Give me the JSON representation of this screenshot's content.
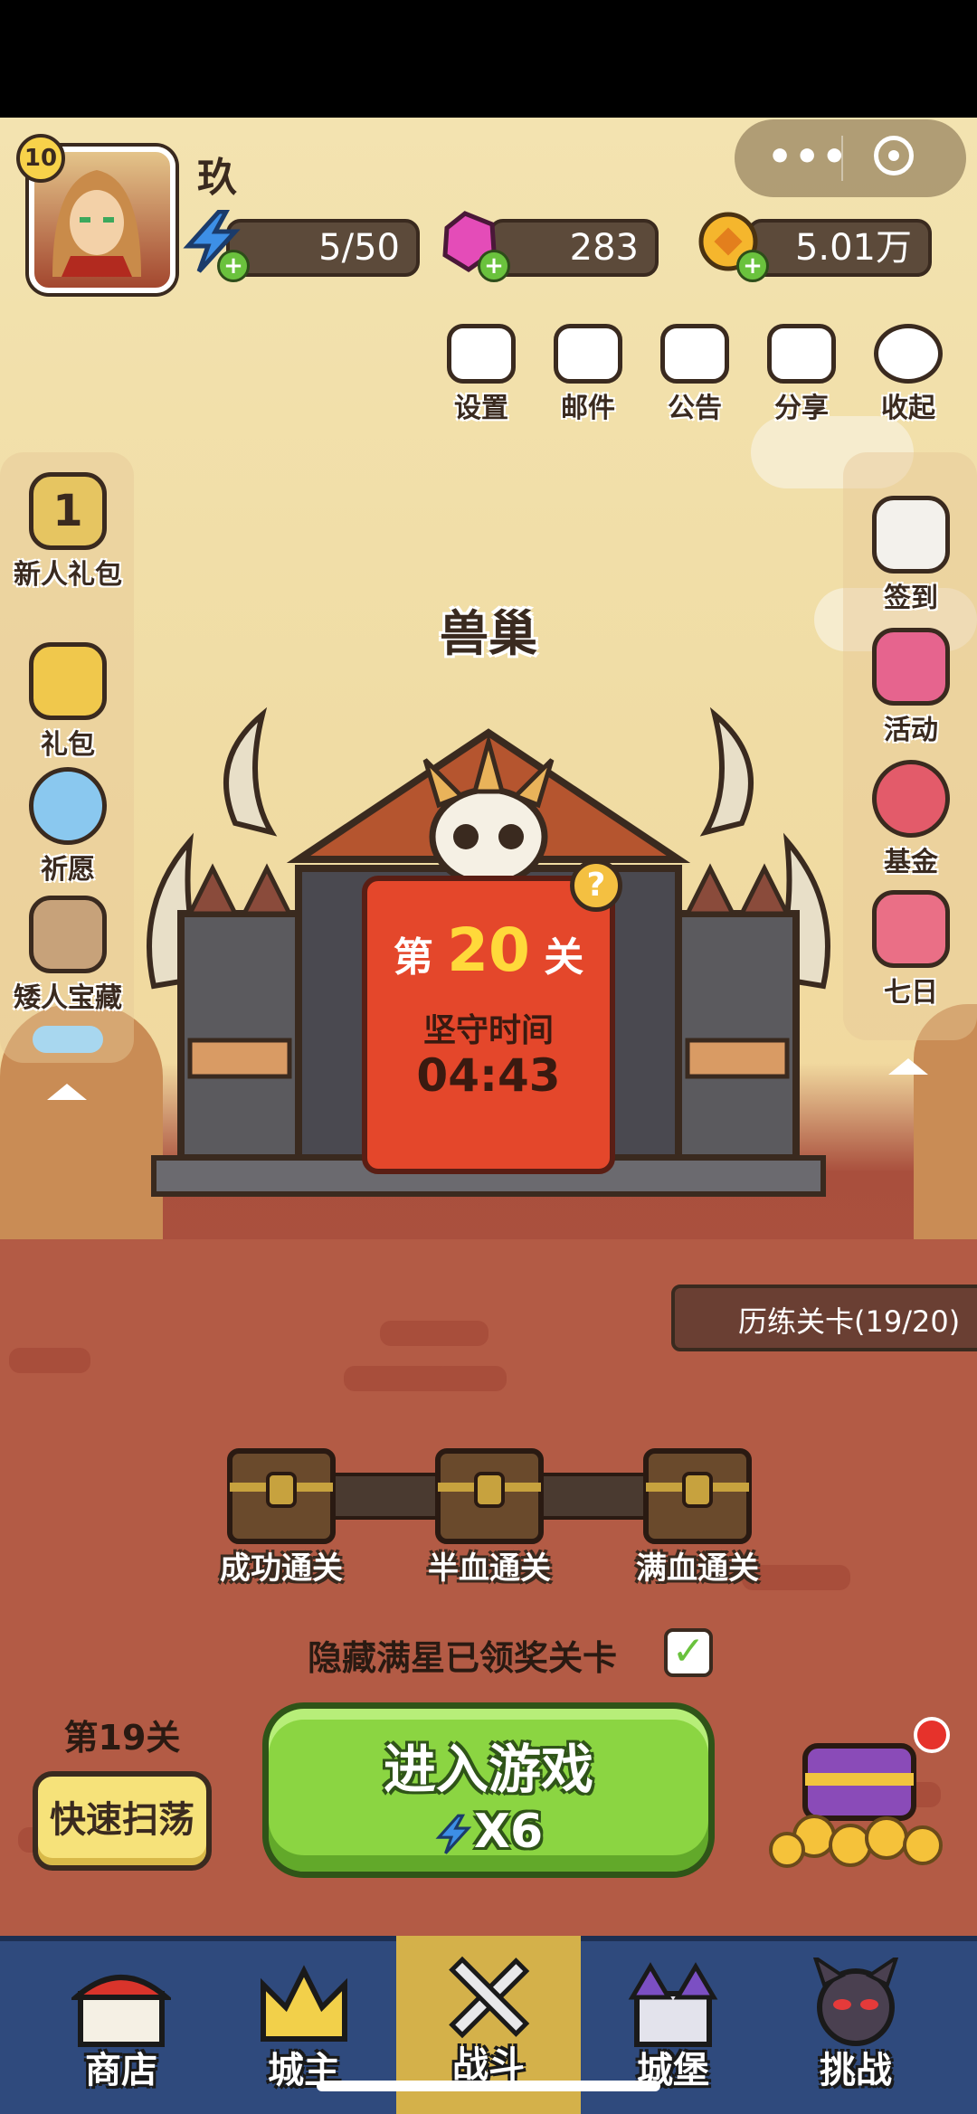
{
  "player": {
    "level": "10",
    "name": "玖"
  },
  "resources": {
    "energy": "5/50",
    "gems": "283",
    "gold": "5.01万"
  },
  "top_menu": [
    {
      "label": "设置",
      "icon": "gear-icon"
    },
    {
      "label": "邮件",
      "icon": "mail-icon"
    },
    {
      "label": "公告",
      "icon": "megaphone-icon"
    },
    {
      "label": "分享",
      "icon": "share-icon"
    },
    {
      "label": "收起",
      "icon": "collapse-icon"
    }
  ],
  "left_menu": [
    {
      "label": "新人礼包",
      "icon": "newbie-pack-icon"
    },
    {
      "label": "礼包",
      "icon": "gift-icon"
    },
    {
      "label": "祈愿",
      "icon": "wish-icon"
    },
    {
      "label": "矮人宝藏",
      "icon": "pickaxe-icon"
    }
  ],
  "left_badge": "1",
  "right_menu": [
    {
      "label": "签到",
      "icon": "calendar-icon"
    },
    {
      "label": "活动",
      "icon": "activity-icon"
    },
    {
      "label": "基金",
      "icon": "fund-icon"
    },
    {
      "label": "七日",
      "icon": "seven-day-icon"
    }
  ],
  "stage": {
    "name": "兽巢",
    "prefix": "第",
    "number": "20",
    "suffix": "关",
    "hold_label": "坚守时间",
    "hold_time": "04:43",
    "help": "?"
  },
  "trial": "历练关卡(19/20)",
  "chests": [
    "成功通关",
    "半血通关",
    "满血通关"
  ],
  "hide_option": "隐藏满星已领奖关卡",
  "hide_checked": "✓",
  "sweep": {
    "stage": "第19关",
    "label": "快速扫荡"
  },
  "enter": {
    "title": "进入游戏",
    "cost": "X6"
  },
  "nav": [
    {
      "label": "商店",
      "icon": "shop-icon"
    },
    {
      "label": "城主",
      "icon": "crown-icon"
    },
    {
      "label": "战斗",
      "icon": "crossed-swords-icon"
    },
    {
      "label": "城堡",
      "icon": "castle-icon"
    },
    {
      "label": "挑战",
      "icon": "demon-icon"
    }
  ],
  "colors": {
    "accent_green": "#8bd542",
    "sign_red": "#e4472b",
    "nav_blue": "#2f4a7d",
    "nav_active": "#d4b14a"
  }
}
